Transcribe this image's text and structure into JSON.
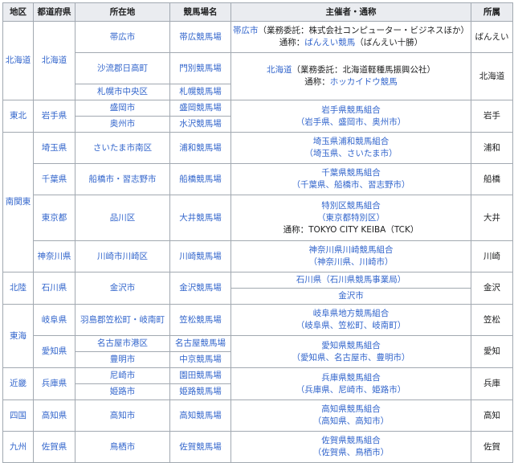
{
  "headers": [
    "地区",
    "都道府県",
    "所在地",
    "競馬場名",
    "主催者・通称",
    "所属"
  ],
  "regions": {
    "hokkaido": "北海道",
    "tohoku": "東北",
    "minamikanto": "南関東",
    "hokuriku": "北陸",
    "tokai": "東海",
    "kinki": "近畿",
    "shikoku": "四国",
    "kyushu": "九州"
  },
  "prefectures": {
    "hokkaido": "北海道",
    "iwate": "岩手県",
    "saitama": "埼玉県",
    "chiba": "千葉県",
    "tokyo": "東京都",
    "kanagawa": "神奈川県",
    "ishikawa": "石川県",
    "gifu": "岐阜県",
    "aichi": "愛知県",
    "hyogo": "兵庫県",
    "kochi": "高知県",
    "saga": "佐賀県"
  },
  "locations": {
    "obihiro": "帯広市",
    "saru": "沙流郡日高町",
    "sapporo": "札幌市中央区",
    "morioka": "盛岡市",
    "oshu": "奥州市",
    "saitama": "さいたま市南区",
    "funabashi": "船橋市・習志野市",
    "shinagawa": "品川区",
    "kawasaki": "川崎市川崎区",
    "kanazawa": "金沢市",
    "hashima": "羽島郡笠松町・岐南町",
    "nagoya": "名古屋市港区",
    "toyoake": "豊明市",
    "amagasaki": "尼崎市",
    "himeji": "姫路市",
    "kochi": "高知市",
    "tosu": "鳥栖市"
  },
  "tracks": {
    "obihiro": "帯広競馬場",
    "monbetsu": "門別競馬場",
    "sapporo": "札幌競馬場",
    "morioka": "盛岡競馬場",
    "mizusawa": "水沢競馬場",
    "urawa": "浦和競馬場",
    "funabashi": "船橋競馬場",
    "ooi": "大井競馬場",
    "kawasaki": "川崎競馬場",
    "kanazawa": "金沢競馬場",
    "kasamatsu": "笠松競馬場",
    "nagoya": "名古屋競馬場",
    "chukyo": "中京競馬場",
    "sonoda": "園田競馬場",
    "himeji": "姫路競馬場",
    "kochi": "高知競馬場",
    "saga": "佐賀競馬場"
  },
  "organizers": {
    "obihiro_1_link": "帯広市",
    "obihiro_1_text": "（業務委託：株式会社コンピューター・ビジネスほか）",
    "obihiro_2_prefix": "通称：",
    "obihiro_2_link": "ばんえい競馬",
    "obihiro_2_suffix": "（ばんえい十勝）",
    "hokkaido_1_link": "北海道",
    "hokkaido_1_text": "（業務委託：北海道軽種馬振興公社）",
    "hokkaido_2_prefix": "通称：",
    "hokkaido_2_link": "ホッカイドウ競馬",
    "iwate_1": "岩手県競馬組合",
    "iwate_2": "（岩手県、盛岡市、奥州市）",
    "saitama_1": "埼玉県浦和競馬組合",
    "saitama_2": "（埼玉県、さいたま市）",
    "chiba_1": "千葉県競馬組合",
    "chiba_2": "（千葉県、船橋市、習志野市）",
    "tokyo_1": "特別区競馬組合",
    "tokyo_2": "（東京都特別区）",
    "tokyo_3": "通称：TOKYO CITY KEIBA（TCK）",
    "kanagawa_1": "神奈川県川崎競馬組合",
    "kanagawa_2": "（神奈川県、川崎市）",
    "ishikawa_1": "石川県（石川県競馬事業局）",
    "ishikawa_2": "金沢市",
    "gifu_1": "岐阜県地方競馬組合",
    "gifu_2": "（岐阜県、笠松町、岐南町）",
    "aichi_1": "愛知県競馬組合",
    "aichi_2": "（愛知県、名古屋市、豊明市）",
    "hyogo_1": "兵庫県競馬組合",
    "hyogo_2": "（兵庫県、尼崎市、姫路市）",
    "kochi_1": "高知県競馬組合",
    "kochi_2": "（高知県、高知市）",
    "saga_1": "佐賀県競馬組合",
    "saga_2": "（佐賀県、鳥栖市）"
  },
  "affiliations": {
    "banei": "ばんえい",
    "hokkaido": "北海道",
    "iwate": "岩手",
    "urawa": "浦和",
    "funabashi": "船橋",
    "ooi": "大井",
    "kawasaki": "川崎",
    "kanazawa": "金沢",
    "kasamatsu": "笠松",
    "aichi": "愛知",
    "hyogo": "兵庫",
    "kochi": "高知",
    "saga": "佐賀"
  },
  "colors": {
    "link": "#3366cc",
    "header_bg": "#eaecf0",
    "border": "#a2a9b1",
    "text": "#202122"
  }
}
